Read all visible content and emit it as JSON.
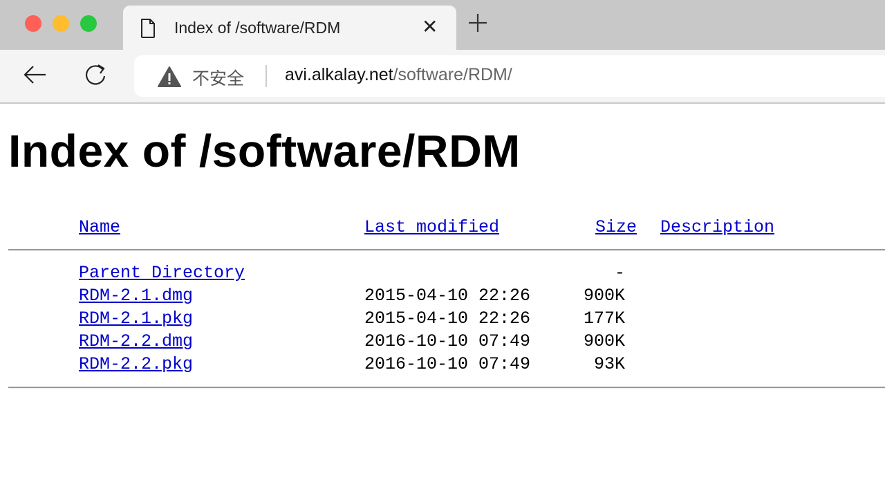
{
  "browser": {
    "tab": {
      "title": "Index of /software/RDM",
      "icon": "document-icon"
    },
    "address_bar": {
      "security_label": "不安全",
      "url_host": "avi.alkalay.net",
      "url_path": "/software/RDM/"
    }
  },
  "page": {
    "heading": "Index of /software/RDM",
    "columns": {
      "name": "Name",
      "last_modified": "Last modified",
      "size": "Size",
      "description": "Description"
    },
    "entries": [
      {
        "name": "Parent Directory",
        "last_modified": "",
        "size": "-",
        "description": ""
      },
      {
        "name": "RDM-2.1.dmg",
        "last_modified": "2015-04-10 22:26",
        "size": "900K",
        "description": ""
      },
      {
        "name": "RDM-2.1.pkg",
        "last_modified": "2015-04-10 22:26",
        "size": "177K",
        "description": ""
      },
      {
        "name": "RDM-2.2.dmg",
        "last_modified": "2016-10-10 07:49",
        "size": "900K",
        "description": ""
      },
      {
        "name": "RDM-2.2.pkg",
        "last_modified": "2016-10-10 07:49",
        "size": "93K",
        "description": ""
      }
    ]
  }
}
